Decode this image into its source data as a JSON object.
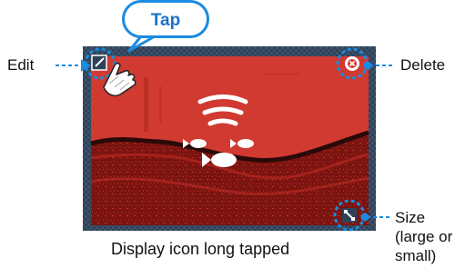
{
  "callout": {
    "tap_label": "Tap"
  },
  "labels": {
    "edit": "Edit",
    "delete": "Delete",
    "size": "Size",
    "size_detail_line1": "(large or",
    "size_detail_line2": "small)"
  },
  "caption": "Display icon long tapped",
  "icons": {
    "edit": "edit-icon",
    "delete": "delete-icon",
    "size": "resize-icon",
    "fish_finder": "fish-finder-icon",
    "hand": "hand-pointer-icon"
  },
  "colors": {
    "accent": "#1a8be0",
    "screen_red": "#d13a31",
    "frame": "#2d3f55"
  }
}
